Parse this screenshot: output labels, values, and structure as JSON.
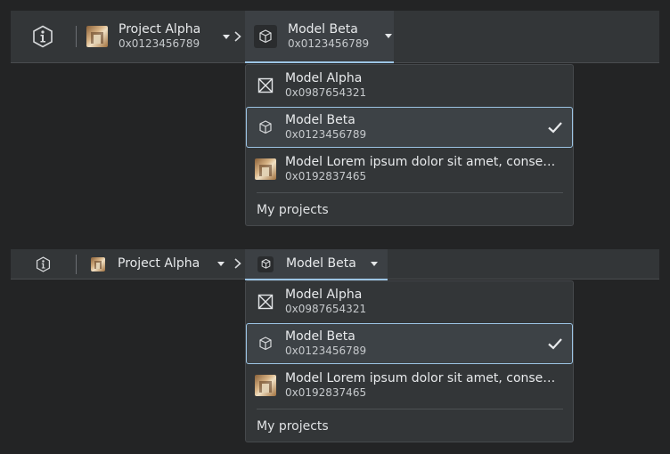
{
  "breadcrumb": {
    "project": {
      "name": "Project Alpha",
      "address": "0x0123456789"
    },
    "model": {
      "name": "Model Beta",
      "address": "0x0123456789"
    }
  },
  "menu": {
    "items": [
      {
        "name": "Model Alpha",
        "address": "0x0987654321",
        "icon": "cross-box-icon",
        "selected": false
      },
      {
        "name": "Model Beta",
        "address": "0x0123456789",
        "icon": "cube-icon",
        "selected": true
      },
      {
        "name": "Model Lorem ipsum dolor sit amet, consectetur adipiscing elit",
        "address": "0x0192837465",
        "icon": "thumbnail",
        "selected": false
      }
    ],
    "footer": "My projects"
  },
  "colors": {
    "accent": "#9cc4e4",
    "bar": "#333638",
    "background": "#232425"
  }
}
